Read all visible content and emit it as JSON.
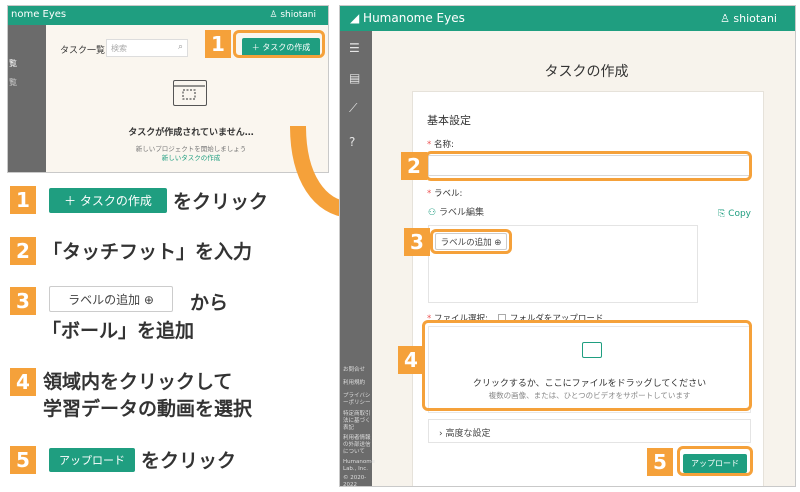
{
  "mini": {
    "brand": "nome Eyes",
    "user": "shiotani",
    "side_item_1": "覧",
    "side_item_2": "覧",
    "list_title": "タスク一覧",
    "search_placeholder": "検索",
    "create_button": "＋ タスクの作成",
    "empty_title": "タスクが作成されていません…",
    "empty_sub": "新しいプロジェクトを開始しましょう",
    "empty_link": "新しいタスクの作成"
  },
  "steps": {
    "s1_num": "1",
    "s1_chip": "＋ タスクの作成",
    "s1_text": "をクリック",
    "s2_num": "2",
    "s2_text": "「タッチフット」を入力",
    "s3_num": "3",
    "s3_chip": "ラベルの追加 ⊕",
    "s3_text_a": "から",
    "s3_text_b": "「ボール」を追加",
    "s4_num": "4",
    "s4_text_a": "領域内をクリックして",
    "s4_text_b": "学習データの動画を選択",
    "s5_num": "5",
    "s5_chip": "アップロード",
    "s5_text": "をクリック"
  },
  "app": {
    "brand": "Humanome Eyes",
    "user": "shiotani",
    "page_title": "タスクの作成",
    "section_title": "基本設定",
    "name_label": "名称:",
    "label_label": "ラベル:",
    "label_edit": "ラベル編集",
    "copy": "Copy",
    "label_add": "ラベルの追加 ⊕",
    "file_select": "ファイル選択:",
    "folder_upload": "フォルダをアップロード",
    "drop_main": "クリックするか、ここにファイルをドラッグしてください",
    "drop_sub": "複数の画像、または、ひとつのビデオをサポートしています",
    "advanced": "›  高度な設定",
    "upload": "アップロード",
    "footer_links": [
      "お問合せ",
      "利用規約",
      "プライバシーポリシー",
      "特定商取引法に基づく表記",
      "利用者情報の外部送信について",
      "Humanome Lab., Inc.",
      "© 2020-2022"
    ],
    "badge_2": "2",
    "badge_3": "3",
    "badge_4": "4",
    "badge_5": "5"
  },
  "badge_1": "1",
  "colors": {
    "accent": "#1f9e80",
    "highlight": "#f5a13a",
    "sidebar": "#6b6b6b"
  }
}
